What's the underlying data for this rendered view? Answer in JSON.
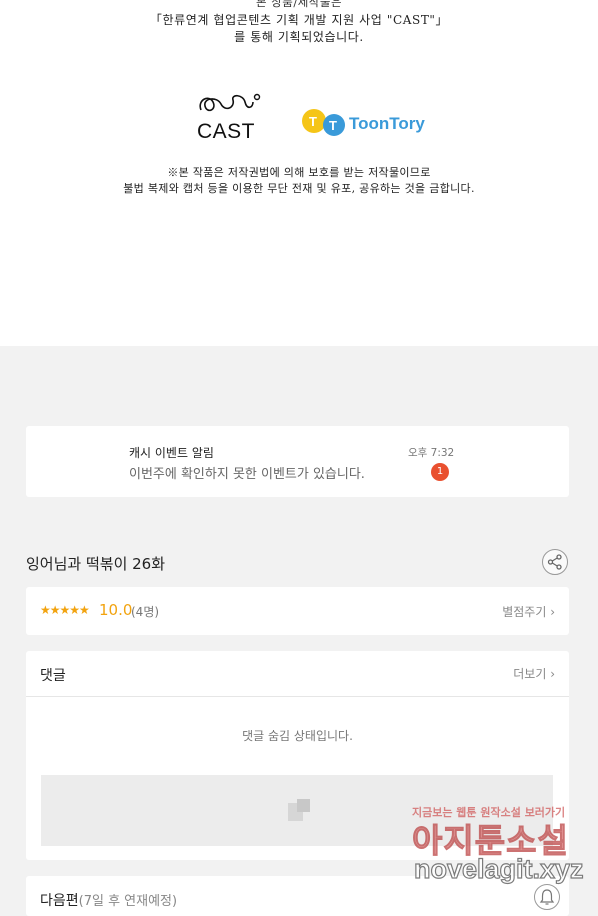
{
  "artwork": {
    "cutoff_line": "본 상품/제작물은",
    "credit_lines": [
      "「한류연계 협업콘텐츠 기획 개발 지원 사업 \"CAST\"」",
      "를 통해 기획되었습니다."
    ],
    "logos": [
      {
        "name": "CAST",
        "text": "CAST"
      },
      {
        "name": "ToonTory",
        "text": "ToonTory"
      }
    ],
    "legal_lines": [
      "※본 작품은 저작권법에 의해 보호를 받는 저작물이므로",
      "불법 복제와 캡처 등을 이용한 무단 전재 및 유포, 공유하는 것을 금합니다."
    ]
  },
  "notification": {
    "title": "캐시 이벤트 알림",
    "message": "이번주에 확인하지 못한 이벤트가 있습니다.",
    "time": "오후 7:32",
    "badge_count": "1"
  },
  "episode": {
    "title": "잉어님과 떡볶이 26화",
    "share_icon": "share-icon"
  },
  "rating": {
    "stars": "★★★★★",
    "score": "10.0",
    "count": "(4명)",
    "rate_label": "별점주기 ›"
  },
  "comments": {
    "header": "댓글",
    "more_label": "더보기 ›",
    "hidden_message": "댓글 숨김 상태입니다."
  },
  "next_episode": {
    "label": "다음편",
    "schedule": "(7일 후 연재예정)",
    "bell_icon": "bell-icon"
  },
  "watermark": {
    "tagline": "지금보는 웹툰 원작소설 보러가기",
    "site_name": "아지툰소설",
    "url": "novelagit.xyz"
  },
  "colors": {
    "accent_orange": "#f2a30f",
    "badge_red": "#e9502f",
    "toontory_blue": "#3a9ad9",
    "toontory_yellow": "#f5c518"
  }
}
